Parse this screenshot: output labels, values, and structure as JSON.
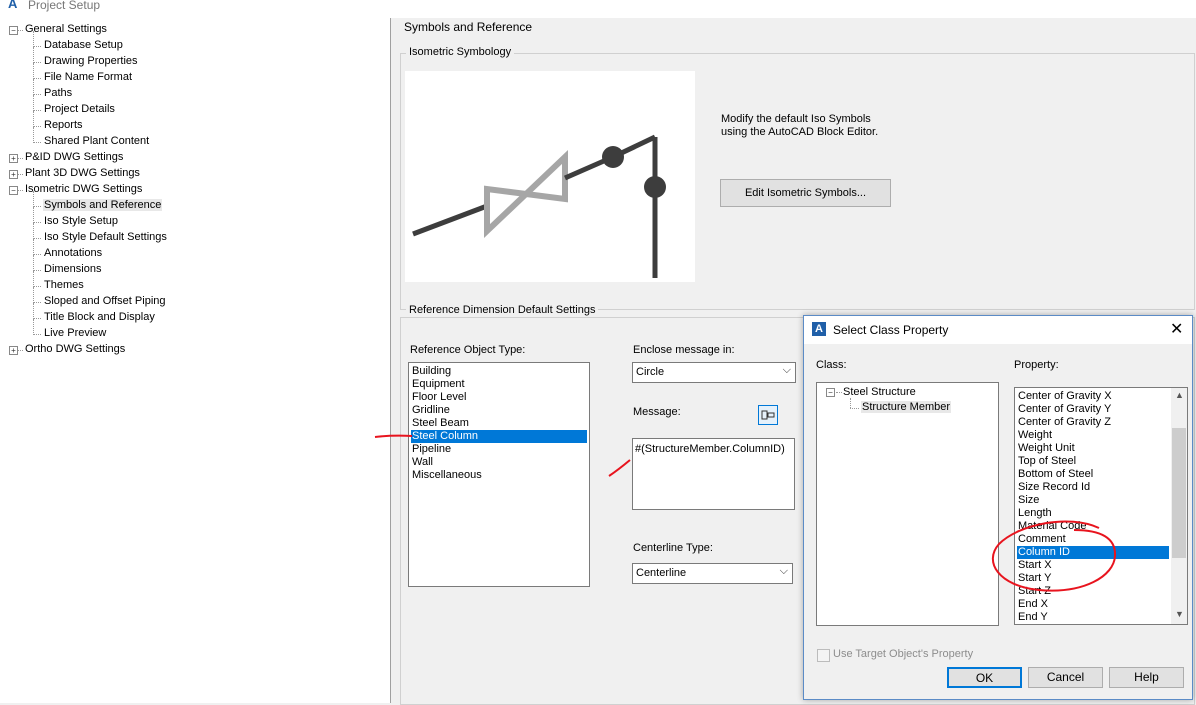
{
  "window": {
    "title": "Project Setup",
    "logo": "A"
  },
  "tree": {
    "nodes": [
      {
        "label": "General Settings",
        "expand": "-"
      },
      {
        "label": "Database Setup"
      },
      {
        "label": "Drawing Properties"
      },
      {
        "label": "File Name Format"
      },
      {
        "label": "Paths"
      },
      {
        "label": "Project Details"
      },
      {
        "label": "Reports"
      },
      {
        "label": "Shared Plant Content"
      },
      {
        "label": "P&ID DWG Settings",
        "expand": "+"
      },
      {
        "label": "Plant 3D DWG Settings",
        "expand": "+"
      },
      {
        "label": "Isometric DWG Settings",
        "expand": "-"
      },
      {
        "label": "Symbols and Reference"
      },
      {
        "label": "Iso Style Setup"
      },
      {
        "label": "Iso Style Default Settings"
      },
      {
        "label": "Annotations"
      },
      {
        "label": "Dimensions"
      },
      {
        "label": "Themes"
      },
      {
        "label": "Sloped and Offset Piping"
      },
      {
        "label": "Title Block and Display"
      },
      {
        "label": "Live Preview"
      },
      {
        "label": "Ortho DWG Settings",
        "expand": "+"
      }
    ]
  },
  "panel": {
    "title": "Symbols and Reference",
    "iso_group": "Isometric Symbology",
    "iso_desc_line1": "Modify the default Iso Symbols",
    "iso_desc_line2": "using the AutoCAD Block Editor.",
    "edit_button": "Edit Isometric Symbols...",
    "ref_group": "Reference Dimension Default Settings",
    "ref_type_label": "Reference Object Type:",
    "ref_types": [
      "Building",
      "Equipment",
      "Floor Level",
      "Gridline",
      "Steel Beam",
      "Steel Column",
      "Pipeline",
      "Wall",
      "Miscellaneous"
    ],
    "ref_selected_index": 5,
    "enclose_label": "Enclose message in:",
    "enclose_value": "Circle",
    "message_label": "Message:",
    "message_value": "#(StructureMember.ColumnID)",
    "centerline_label": "Centerline Type:",
    "centerline_value": "Centerline"
  },
  "dialog": {
    "title": "Select Class Property",
    "logo": "A",
    "class_label": "Class:",
    "class_root": "Steel Structure",
    "class_child": "Structure Member",
    "property_label": "Property:",
    "properties": [
      "Center of Gravity X",
      "Center of Gravity Y",
      "Center of Gravity Z",
      "Weight",
      "Weight Unit",
      "Top of Steel",
      "Bottom of Steel",
      "Size Record Id",
      "Size",
      "Length",
      "Material Code",
      "Comment",
      "Column ID",
      "Start X",
      "Start Y",
      "Start Z",
      "End X",
      "End Y"
    ],
    "property_selected_index": 12,
    "use_target_label": "Use Target Object's Property",
    "ok_label": "OK",
    "cancel_label": "Cancel",
    "help_label": "Help"
  },
  "colors": {
    "selection": "#0078d7",
    "annotation": "#e8141e"
  }
}
